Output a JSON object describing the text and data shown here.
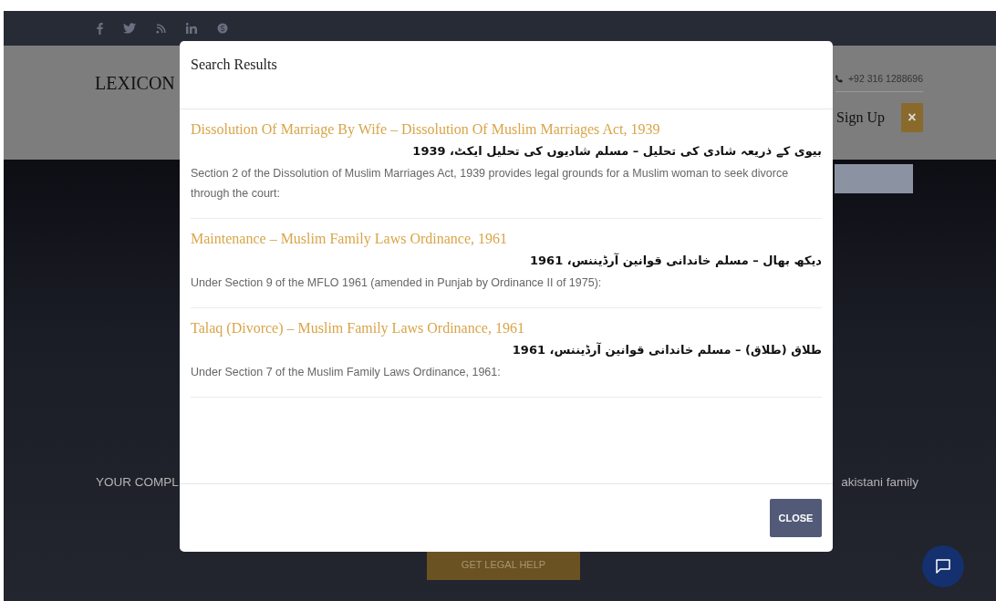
{
  "header": {
    "logo": "LEXICON",
    "phone": "+92 316 1288696",
    "signup": "Sign Up",
    "close_icon": "×"
  },
  "hero": {
    "text_left": "YOUR COMPL",
    "text_right": "akistani family",
    "button": "GET LEGAL HELP"
  },
  "modal": {
    "title": "Search Results",
    "results": [
      {
        "title": "Dissolution Of Marriage By Wife – Dissolution Of Muslim Marriages Act, 1939",
        "urdu": "بیوی کے ذریعہ شادی کی تحلیل – مسلم شادیوں کی تحلیل ایکٹ، 1939",
        "description": "Section 2 of the Dissolution of Muslim Marriages Act, 1939 provides legal grounds for a Muslim woman to seek divorce through the court:"
      },
      {
        "title": "Maintenance – Muslim Family Laws Ordinance, 1961",
        "urdu": "دیکھ بھال – مسلم خاندانی قوانین آرڈیننس، 1961",
        "description": "Under Section 9 of the MFLO 1961 (amended in Punjab by Ordinance II of 1975):"
      },
      {
        "title": "Talaq (Divorce) – Muslim Family Laws Ordinance, 1961",
        "urdu": "طلاق (طلاق) – مسلم خاندانی قوانین آرڈیننس، 1961",
        "description": "Under Section 7 of the Muslim Family Laws Ordinance, 1961:"
      }
    ],
    "close_button": "CLOSE"
  }
}
